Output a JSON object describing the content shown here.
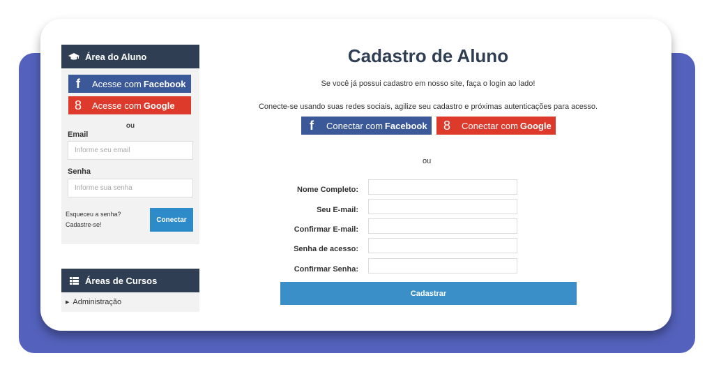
{
  "sidebar": {
    "login_panel": {
      "title": "Área do Aluno",
      "icon": "graduation-cap-icon",
      "facebook_btn": {
        "prefix": "Acesse com",
        "brand": "Facebook"
      },
      "google_btn": {
        "prefix": "Acesse com",
        "brand": "Google"
      },
      "or_text": "ou",
      "email_label": "Email",
      "email_placeholder": "Informe seu email",
      "password_label": "Senha",
      "password_placeholder": "Informe sua senha",
      "forgot_link": "Esqueceu a senha?",
      "register_link": "Cadastre-se!",
      "connect_button": "Conectar"
    },
    "courses_panel": {
      "title": "Áreas de Cursos",
      "icon": "list-icon",
      "items": [
        "Administração"
      ]
    }
  },
  "main": {
    "title": "Cadastro de Aluno",
    "already_registered": "Se você já possui cadastro em nosso site, faça o login ao lado!",
    "social_info": "Conecte-se usando suas redes sociais, agilize seu cadastro e próximas autenticações para acesso.",
    "facebook_btn": {
      "prefix": "Conectar com",
      "brand": "Facebook"
    },
    "google_btn": {
      "prefix": "Conectar com",
      "brand": "Google"
    },
    "or_text": "ou",
    "fields": [
      {
        "label": "Nome Completo:",
        "value": ""
      },
      {
        "label": "Seu E-mail:",
        "value": ""
      },
      {
        "label": "Confirmar E-mail:",
        "value": ""
      },
      {
        "label": "Senha de acesso:",
        "value": ""
      },
      {
        "label": "Confirmar Senha:",
        "value": ""
      }
    ],
    "submit_button": "Cadastrar"
  },
  "colors": {
    "background_accent": "#5462bd",
    "panel_header": "#2f3e53",
    "facebook": "#3b5998",
    "google": "#dd3a2c",
    "primary_button": "#3a8fc9"
  }
}
